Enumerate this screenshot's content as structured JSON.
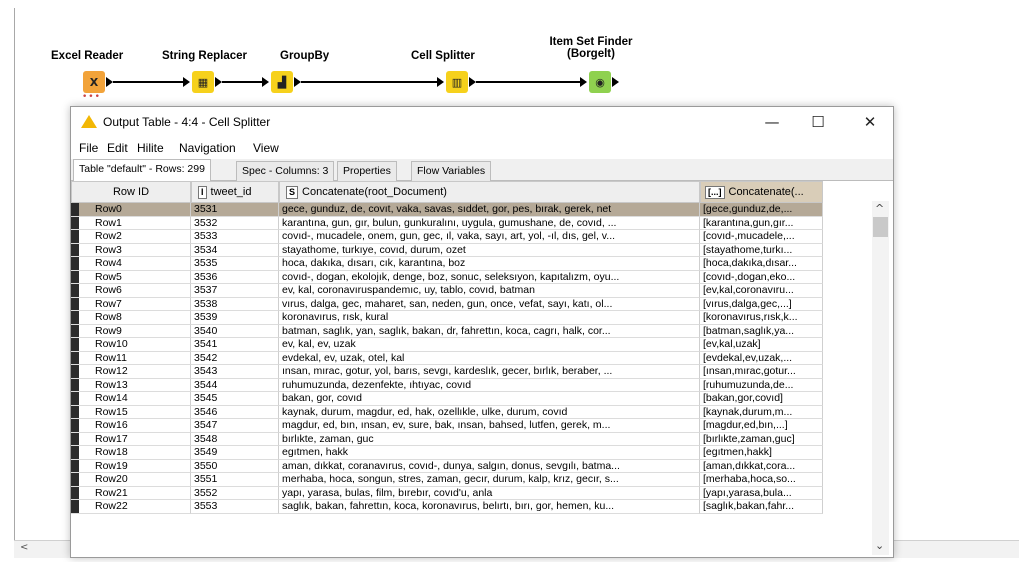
{
  "workflow": {
    "nodes": [
      {
        "label": "Excel Reader",
        "icon": "excel-reader-icon",
        "glyph": "X"
      },
      {
        "label": "String Replacer",
        "icon": "string-replacer-icon",
        "glyph": "▦"
      },
      {
        "label": "GroupBy",
        "icon": "groupby-icon",
        "glyph": "▟"
      },
      {
        "label": "Cell Splitter",
        "icon": "cell-splitter-icon",
        "glyph": "▥"
      },
      {
        "label": "Item Set Finder (Borgelt)",
        "label_line1": "Item Set Finder",
        "label_line2": "(Borgelt)",
        "icon": "item-set-finder-icon",
        "glyph": "◉"
      }
    ],
    "status_dots": "•••"
  },
  "window": {
    "title": "Output Table - 4:4 - Cell Splitter",
    "controls": {
      "minimize": "—",
      "maximize": "☐",
      "close": "✕"
    },
    "menu": [
      "File",
      "Edit",
      "Hilite",
      "Navigation",
      "View"
    ],
    "tabs": [
      {
        "label": "Table \"default\" - Rows: 299",
        "active": true
      },
      {
        "label": "Spec - Columns: 3",
        "active": false
      },
      {
        "label": "Properties",
        "active": false
      },
      {
        "label": "Flow Variables",
        "active": false
      }
    ]
  },
  "table": {
    "headers": {
      "row_id": "Row ID",
      "col1": {
        "type_icon": "I",
        "name": "tweet_id"
      },
      "col2": {
        "type_icon": "S",
        "name": "Concatenate(root_Document)"
      },
      "col3": {
        "type_icon": "[...]",
        "name": "Concatenate(..."
      }
    },
    "rows": [
      {
        "id": "Row0",
        "tweet_id": "3531",
        "text": "gece, gunduz, de, covıt, vaka, savas, sıddet, gor, pes, bırak, gerek, net",
        "list": "[gece,gunduz,de,..."
      },
      {
        "id": "Row1",
        "tweet_id": "3532",
        "text": "karantına, gun, gır, bulun, gunkuralını, uygula, gumushane, de, covıd, ...",
        "list": "[karantına,gun,gır..."
      },
      {
        "id": "Row2",
        "tweet_id": "3533",
        "text": "covıd-, mucadele, onem, gun, gec, ıl, vaka, sayı, art, yol, -ıl, dıs, gel, v...",
        "list": "[covıd-,mucadele,..."
      },
      {
        "id": "Row3",
        "tweet_id": "3534",
        "text": "stayathome, turkıye, covıd, durum, ozet",
        "list": "[stayathome,turkı..."
      },
      {
        "id": "Row4",
        "tweet_id": "3535",
        "text": "hoca, dakıka, dısarı, cık, karantına, boz",
        "list": "[hoca,dakıka,dısar..."
      },
      {
        "id": "Row5",
        "tweet_id": "3536",
        "text": "covıd-, dogan, ekolojık, denge, boz, sonuc, seleksıyon, kapıtalızm, oyu...",
        "list": "[covıd-,dogan,eko..."
      },
      {
        "id": "Row6",
        "tweet_id": "3537",
        "text": "ev, kal, coronavıruspandemıc, uy, tablo, covıd, batman",
        "list": "[ev,kal,coronavıru..."
      },
      {
        "id": "Row7",
        "tweet_id": "3538",
        "text": "vırus, dalga, gec, maharet, san, neden, gun, once, vefat, sayı, katı, ol...",
        "list": "[vırus,dalga,gec,...]"
      },
      {
        "id": "Row8",
        "tweet_id": "3539",
        "text": "koronavırus, rısk, kural",
        "list": "[koronavırus,rısk,k..."
      },
      {
        "id": "Row9",
        "tweet_id": "3540",
        "text": "batman, saglık, yan, saglık, bakan, dr, fahrettın, koca, cagrı, halk, cor...",
        "list": "[batman,saglık,ya..."
      },
      {
        "id": "Row10",
        "tweet_id": "3541",
        "text": "ev, kal, ev, uzak",
        "list": "[ev,kal,uzak]"
      },
      {
        "id": "Row11",
        "tweet_id": "3542",
        "text": "evdekal, ev, uzak, otel, kal",
        "list": "[evdekal,ev,uzak,..."
      },
      {
        "id": "Row12",
        "tweet_id": "3543",
        "text": "ınsan, mırac, gotur, yol, barıs, sevgı, kardeslık, gecer, bırlık, beraber, ...",
        "list": "[ınsan,mırac,gotur..."
      },
      {
        "id": "Row13",
        "tweet_id": "3544",
        "text": "ruhumuzunda, dezenfekte, ıhtıyac, covıd",
        "list": "[ruhumuzunda,de..."
      },
      {
        "id": "Row14",
        "tweet_id": "3545",
        "text": "bakan, gor, covıd",
        "list": "[bakan,gor,covıd]"
      },
      {
        "id": "Row15",
        "tweet_id": "3546",
        "text": "kaynak, durum, magdur, ed, hak, ozellıkle, ulke, durum, covıd",
        "list": "[kaynak,durum,m..."
      },
      {
        "id": "Row16",
        "tweet_id": "3547",
        "text": "magdur, ed, bın, ınsan, ev, sure, bak, ınsan, bahsed, lutfen, gerek, m...",
        "list": "[magdur,ed,bın,...]"
      },
      {
        "id": "Row17",
        "tweet_id": "3548",
        "text": "bırlıkte, zaman, guc",
        "list": "[bırlıkte,zaman,guc]"
      },
      {
        "id": "Row18",
        "tweet_id": "3549",
        "text": "egıtmen, hakk",
        "list": "[egıtmen,hakk]"
      },
      {
        "id": "Row19",
        "tweet_id": "3550",
        "text": "aman, dıkkat, coranavırus, covıd-, dunya, salgın, donus, sevgılı, batma...",
        "list": "[aman,dıkkat,cora..."
      },
      {
        "id": "Row20",
        "tweet_id": "3551",
        "text": "merhaba, hoca, songun, stres, zaman, gecır, durum, kalp, krız, gecır, s...",
        "list": "[merhaba,hoca,so..."
      },
      {
        "id": "Row21",
        "tweet_id": "3552",
        "text": "yapı, yarasa, bulas, film, bırebır, covıd'u, anla",
        "list": "[yapı,yarasa,bula..."
      },
      {
        "id": "Row22",
        "tweet_id": "3553",
        "text": "saglık, bakan, fahrettın, koca,  koronavırus, belırtı, bırı, gor, hemen, ku...",
        "list": "[saglık,bakan,fahr..."
      }
    ],
    "selected_row": "Row0"
  },
  "colors": {
    "reader_node": "#f2a33a",
    "manipulator_node": "#f6d11c",
    "other_node": "#8fd14f",
    "selected_row": "#b5a997",
    "warning_icon": "#f2b705"
  }
}
